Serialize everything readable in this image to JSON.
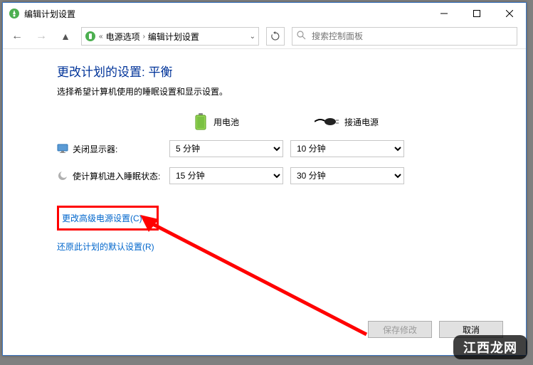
{
  "window": {
    "title": "编辑计划设置"
  },
  "breadcrumb": {
    "item1": "电源选项",
    "item2": "编辑计划设置"
  },
  "search": {
    "placeholder": "搜索控制面板"
  },
  "heading": "更改计划的设置: 平衡",
  "subtext": "选择希望计算机使用的睡眠设置和显示设置。",
  "columns": {
    "battery": "用电池",
    "plugged": "接通电源"
  },
  "rows": {
    "display_off": "关闭显示器:",
    "sleep": "使计算机进入睡眠状态:"
  },
  "values": {
    "display_battery": "5 分钟",
    "display_plugged": "10 分钟",
    "sleep_battery": "15 分钟",
    "sleep_plugged": "30 分钟"
  },
  "links": {
    "advanced": "更改高级电源设置(C)",
    "restore": "还原此计划的默认设置(R)"
  },
  "buttons": {
    "save": "保存修改",
    "cancel": "取消"
  },
  "watermark": "江西龙网"
}
